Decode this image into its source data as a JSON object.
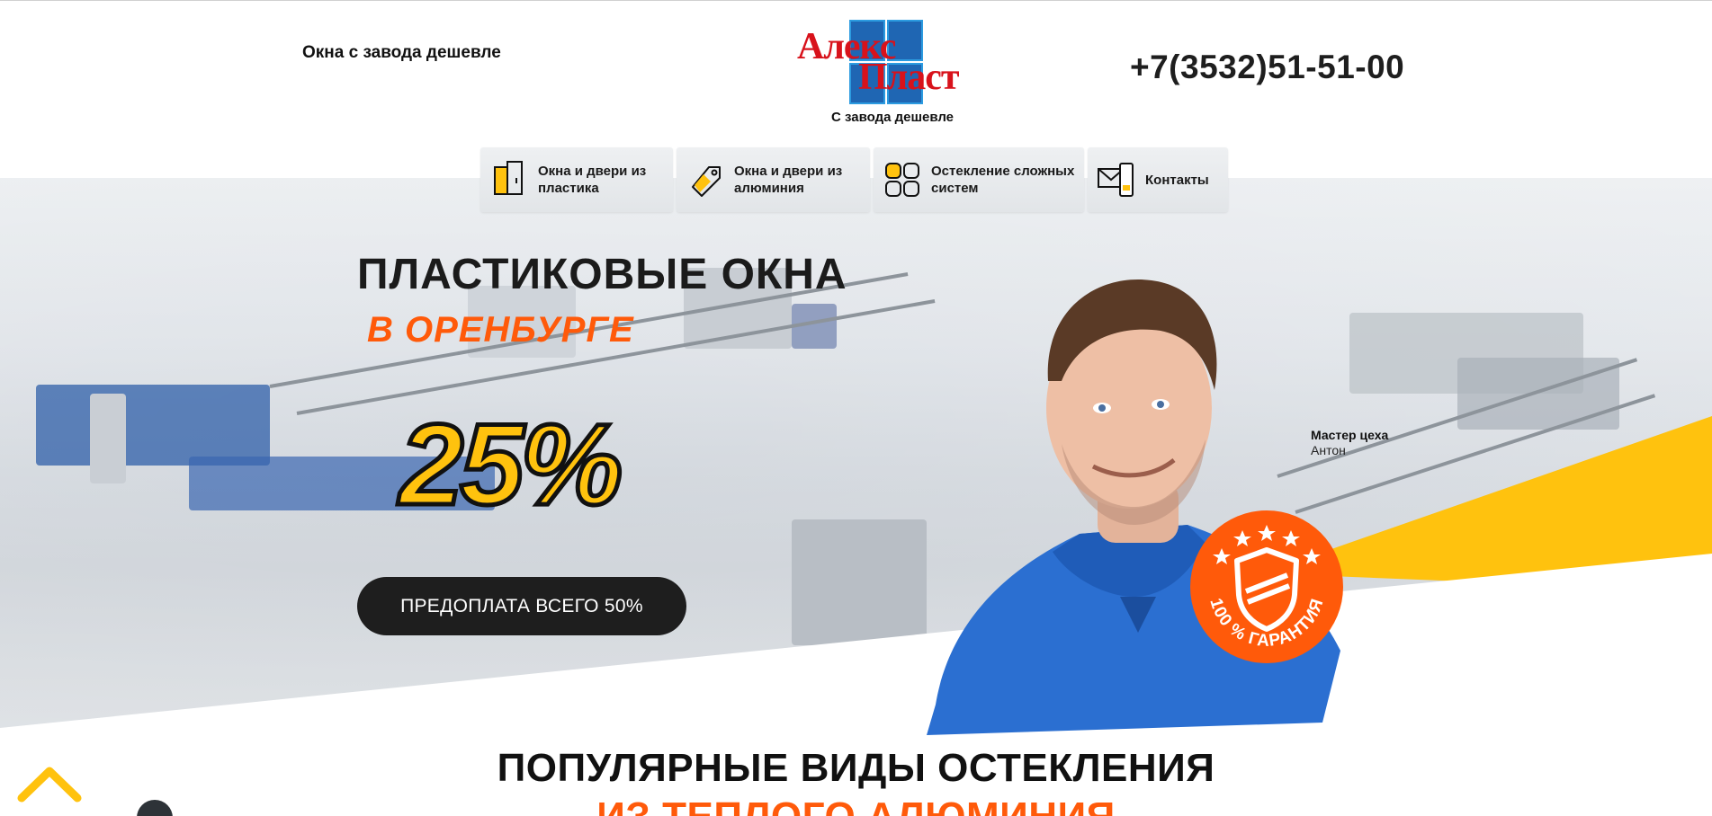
{
  "header": {
    "tagline": "Окна с завода дешевле",
    "logo": {
      "line1": "Алекс",
      "line2": "Пласт",
      "subtitle": "С завода дешевле"
    },
    "phone": "+7(3532)51-51-00"
  },
  "nav": {
    "items": [
      {
        "label": "Окна и двери из пластика",
        "icon": "window-door-icon"
      },
      {
        "label": "Окна и двери из алюминия",
        "icon": "tag-icon"
      },
      {
        "label": "Остекление сложных систем",
        "icon": "grid-icon"
      },
      {
        "label": "Контакты",
        "icon": "envelope-phone-icon"
      }
    ]
  },
  "hero": {
    "title_line1": "ПЛАСТИКОВЫЕ ОКНА",
    "title_line2": "В ОРЕНБУРГЕ",
    "discount": "25%",
    "cta_label": "ПРЕДОПЛАТА ВСЕГО 50%",
    "master": {
      "role": "Мастер цеха",
      "name": "Антон"
    },
    "badge_text": "100 % ГАРАНТИЯ"
  },
  "section": {
    "title": "ПОПУЛЯРНЫЕ ВИДЫ ОСТЕКЛЕНИЯ",
    "subtitle": "ИЗ ТЕПЛОГО АЛЮМИНИЯ"
  },
  "colors": {
    "accent_orange": "#ff5a0a",
    "accent_yellow": "#ffc20e",
    "logo_red": "#d8121b",
    "logo_blue": "#1f66b3",
    "dark": "#1e1e1e"
  }
}
